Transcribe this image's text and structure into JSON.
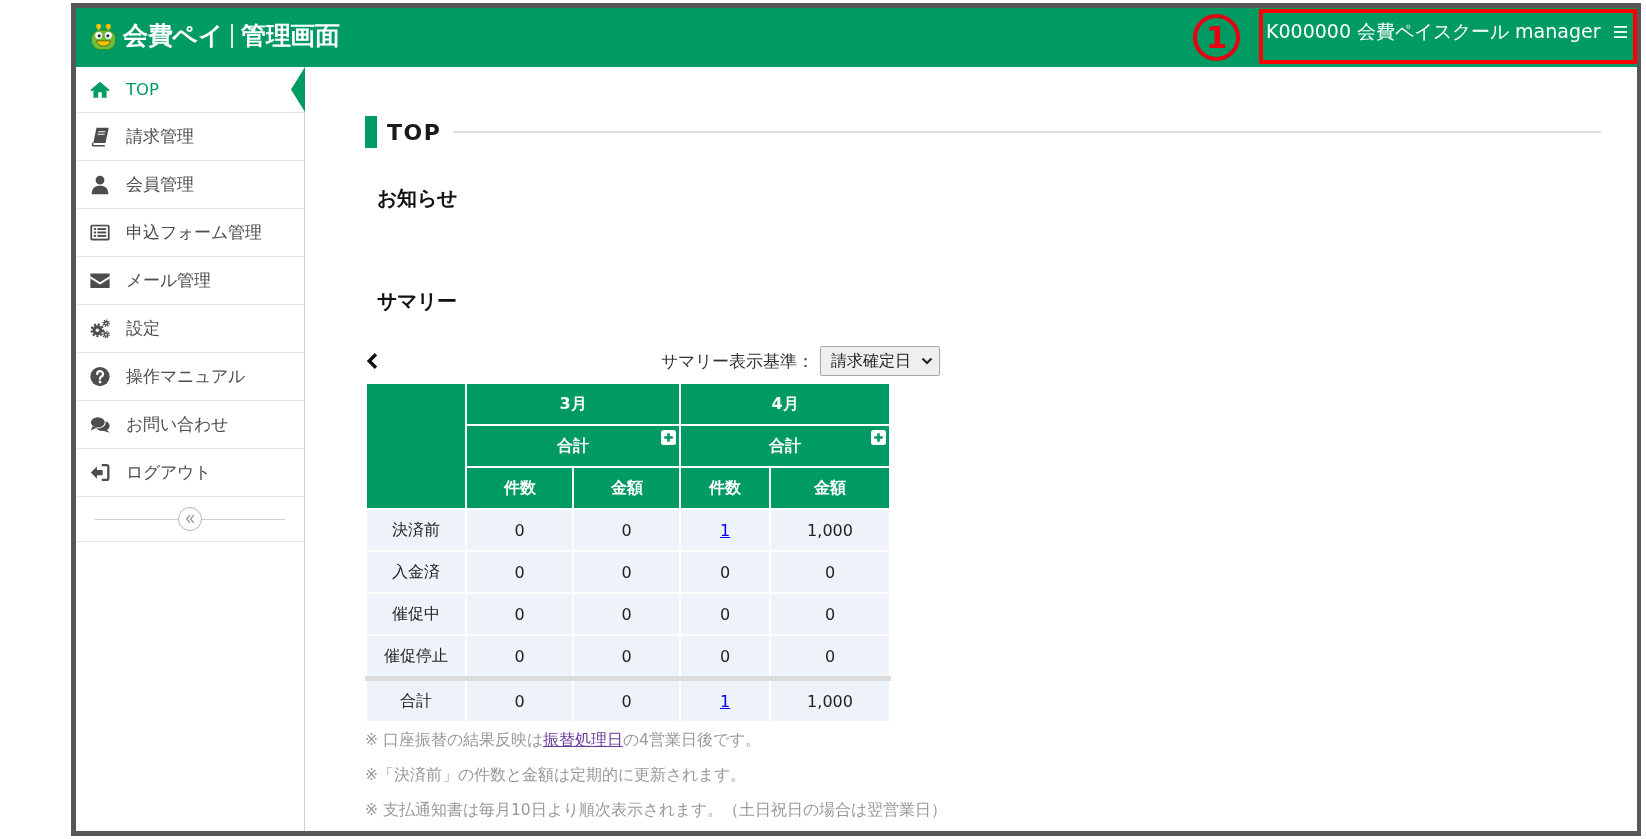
{
  "header": {
    "logo": {
      "service_name": "会費ペイ",
      "subtitle": "管理画面"
    },
    "callout": {
      "number": "1"
    },
    "account_menu": {
      "label": "K000000 会費ペイスクール manager",
      "highlighted": true
    }
  },
  "sidebar": {
    "items": [
      {
        "label": "TOP",
        "selected": true
      },
      {
        "label": "請求管理",
        "selected": false
      },
      {
        "label": "会員管理",
        "selected": false
      },
      {
        "label": "申込フォーム管理",
        "selected": false
      },
      {
        "label": "メール管理",
        "selected": false
      },
      {
        "label": "設定",
        "selected": false
      },
      {
        "label": "操作マニュアル",
        "selected": false
      },
      {
        "label": "お問い合わせ",
        "selected": false
      },
      {
        "label": "ログアウト",
        "selected": false
      }
    ]
  },
  "page_title": "TOP",
  "notices": {
    "title": "お知らせ"
  },
  "summary": {
    "title": "サマリー",
    "basis": {
      "label": "サマリー表示基準：",
      "value": "請求確定日"
    },
    "table": {
      "months": [
        {
          "label": "3月",
          "subtotal": "合計",
          "columns": [
            "件数",
            "金額"
          ]
        },
        {
          "label": "4月",
          "subtotal": "合計",
          "columns": [
            "件数",
            "金額"
          ]
        }
      ],
      "rows": [
        {
          "label": "決済前",
          "cells": [
            {
              "value": "0",
              "link": false
            },
            {
              "value": "0",
              "link": false
            },
            {
              "value": "1",
              "link": true
            },
            {
              "value": "1,000",
              "link": false
            }
          ]
        },
        {
          "label": "入金済",
          "cells": [
            {
              "value": "0",
              "link": false
            },
            {
              "value": "0",
              "link": false
            },
            {
              "value": "0",
              "link": false
            },
            {
              "value": "0",
              "link": false
            }
          ]
        },
        {
          "label": "催促中",
          "cells": [
            {
              "value": "0",
              "link": false
            },
            {
              "value": "0",
              "link": false
            },
            {
              "value": "0",
              "link": false
            },
            {
              "value": "0",
              "link": false
            }
          ]
        },
        {
          "label": "催促停止",
          "cells": [
            {
              "value": "0",
              "link": false
            },
            {
              "value": "0",
              "link": false
            },
            {
              "value": "0",
              "link": false
            },
            {
              "value": "0",
              "link": false
            }
          ]
        }
      ],
      "total_row": {
        "label": "合計",
        "cells": [
          {
            "value": "0",
            "link": false
          },
          {
            "value": "0",
            "link": false
          },
          {
            "value": "1",
            "link": true
          },
          {
            "value": "1,000",
            "link": false
          }
        ]
      }
    },
    "notes": [
      {
        "parts": [
          {
            "kind": "text",
            "text": "※ 口座振替の結果反映は"
          },
          {
            "kind": "link",
            "text": "振替処理日"
          },
          {
            "kind": "text",
            "text": "の4営業日後です。"
          }
        ]
      },
      {
        "parts": [
          {
            "kind": "text",
            "text": "※「決済前」の件数と金額は定期的に更新されます。"
          }
        ]
      },
      {
        "parts": [
          {
            "kind": "text",
            "text": "※ 支払通知書は毎月10日より順次表示されます。（土日祝日の場合は翌営業日）"
          }
        ]
      }
    ]
  }
}
